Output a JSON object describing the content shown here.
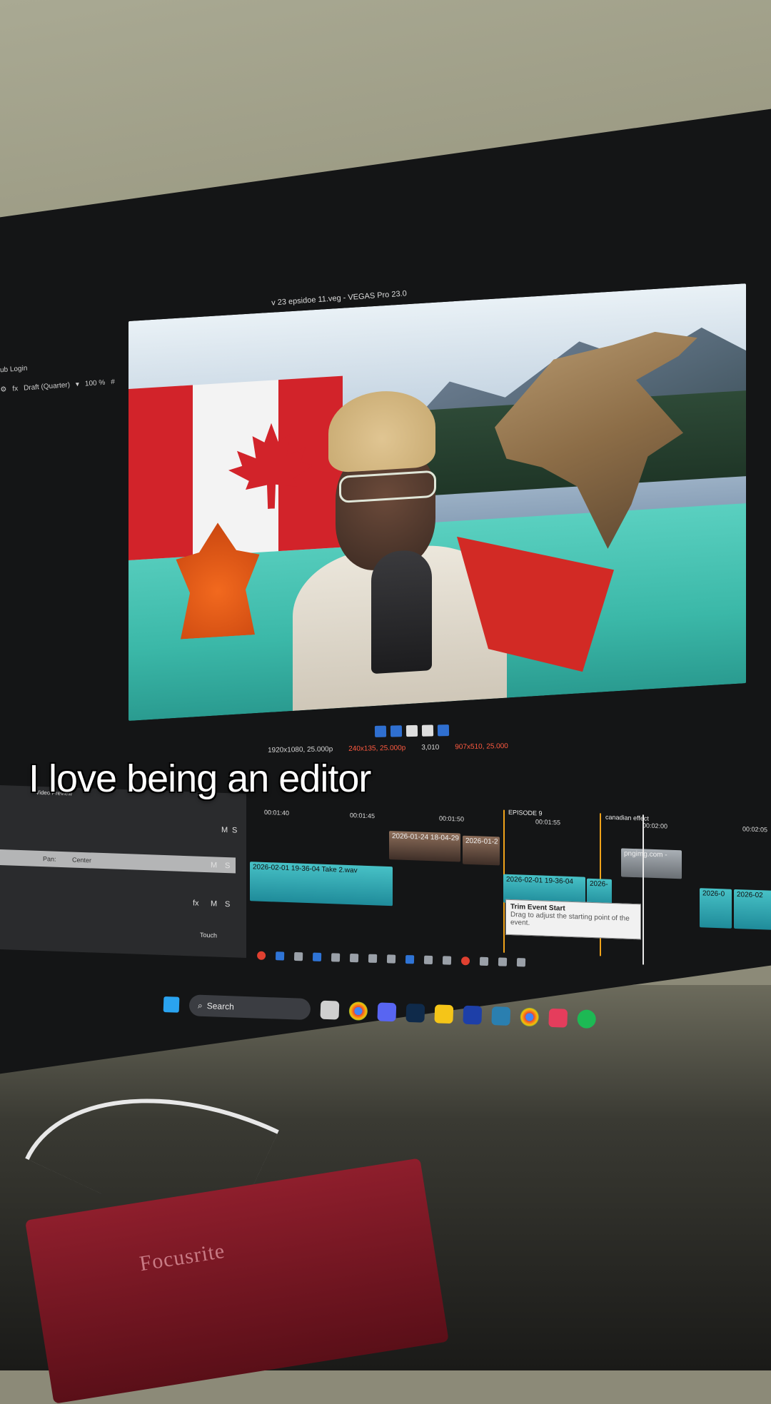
{
  "caption": "I love being an editor",
  "window_title": "v 23 epsidoe 11.veg - VEGAS Pro 23.0",
  "hub_login": "ub Login",
  "preview_toolbar": {
    "quality": "Draft (Quarter)",
    "zoom": "100 %"
  },
  "status_bar": {
    "project": "1920x1080, 25.000p",
    "preview": "240x135, 25.000p",
    "frame": "3,010",
    "display": "907x510, 25.000"
  },
  "video_preview_tab": "Video Preview",
  "track_header": {
    "m_label": "M",
    "s_label": "S",
    "pan_label": "Pan:",
    "pan_value": "Center",
    "touch_label": "Touch",
    "fx_label": "fx"
  },
  "ruler": [
    "00:01:40",
    "00:01:45",
    "00:01:50",
    "00:01:55",
    "00:02:00",
    "00:02:05"
  ],
  "markers": [
    {
      "label": "EPISODE 9"
    },
    {
      "label": "canadian effect"
    }
  ],
  "clips": [
    {
      "label": "2026-01-24 18-04-29"
    },
    {
      "label": "2026-01-2"
    },
    {
      "label": "2026-02-01 19-36-04 Take 2.wav"
    },
    {
      "label": "2026-02-01 19-36-04"
    },
    {
      "label": "2026-"
    },
    {
      "label": "pngimg.com -"
    },
    {
      "label": "2026-0"
    },
    {
      "label": "2026-02"
    },
    {
      "label": "2026"
    }
  ],
  "tooltip": {
    "title": "Trim Event Start",
    "desc": "Drag to adjust the starting point of the event."
  },
  "taskbar": {
    "search": "Search"
  },
  "hardware": {
    "focusrite_logo": "Focusrite"
  },
  "colors": {
    "accent_blue": "#2f6fd0",
    "marker_orange": "#f0a21a",
    "audio_clip": "#47c1c6",
    "status_red": "#ff5a40"
  }
}
